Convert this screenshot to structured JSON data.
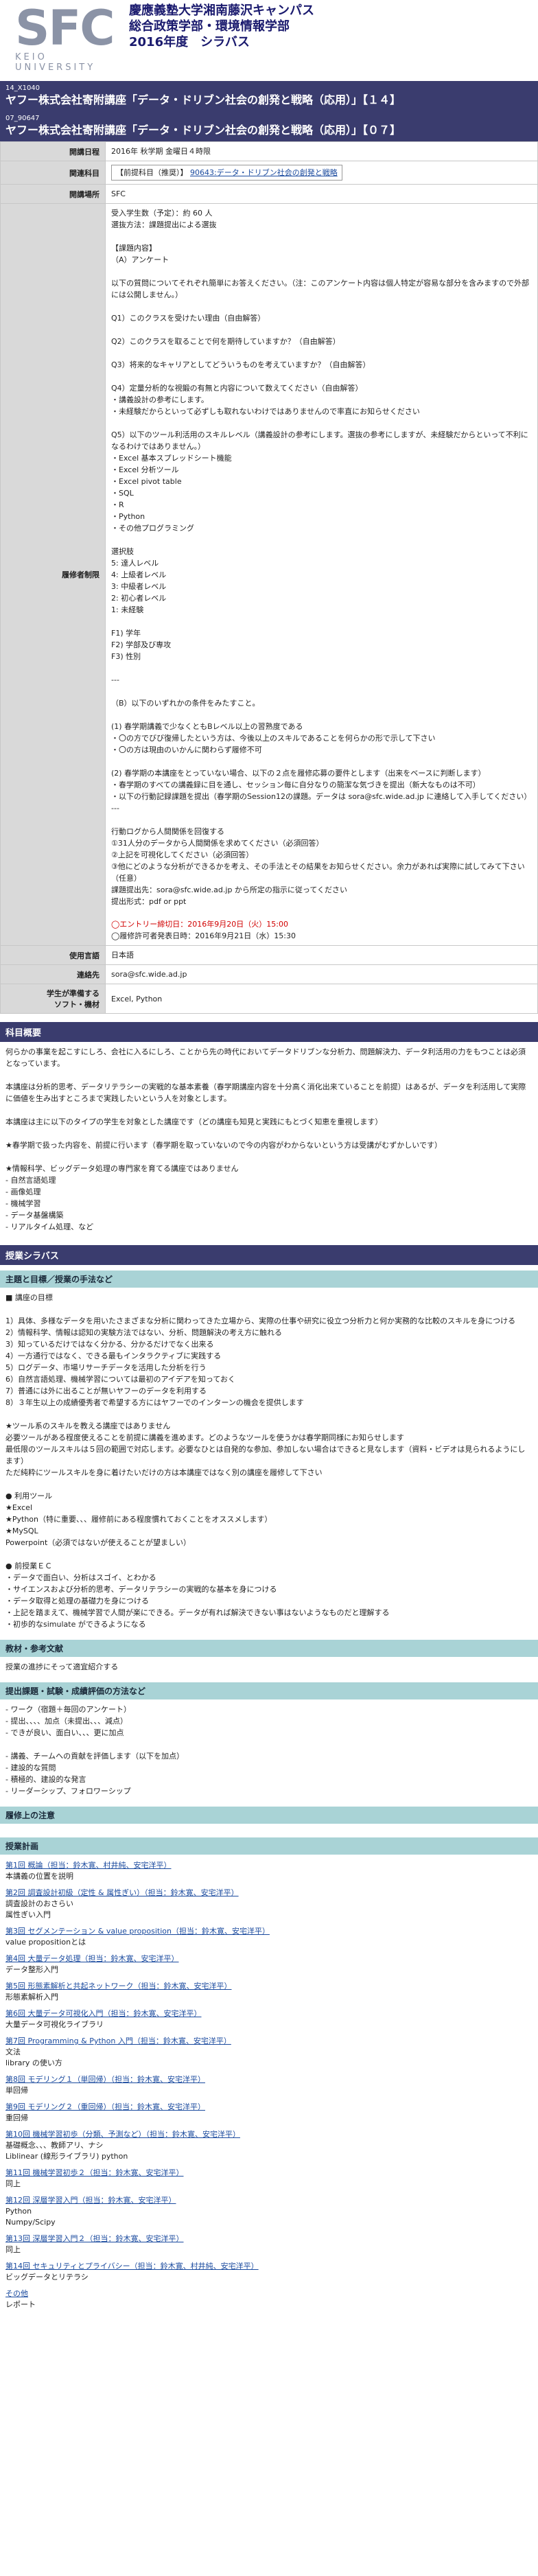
{
  "header": {
    "logo_text": "SFC",
    "logo_sub": "KEIO UNIVERSITY",
    "title_line1": "慶應義塾大学湘南藤沢キャンパス",
    "title_line2": "総合政策学部・環境情報学部",
    "title_line3": "2016年度　シラバス"
  },
  "courses": [
    {
      "code": "14_X1040",
      "title": "ヤフー株式会社寄附講座「データ・ドリブン社会の創発と戦略（応用）」【１４】"
    },
    {
      "code": "07_90647",
      "title": "ヤフー株式会社寄附講座「データ・ドリブン社会の創発と戦略（応用）」【０７】"
    }
  ],
  "info": {
    "period_label": "開講日程",
    "period_value": "2016年 秋学期 金曜日４時限",
    "related_label": "関連科目",
    "related_prefix": "【前提科目（推奨）】",
    "related_link": "90643:データ・ドリブン社会の創発と戦略",
    "place_label": "開講場所",
    "place_value": "SFC",
    "requirements_label": "履修者制限",
    "requirements_text": "受入学生数（予定）：約 60 人\n選抜方法：課題提出による選抜\n\n【課題内容】\n（A）アンケート\n\n以下の質問についてそれぞれ簡単にお答えください。（注：このアンケート内容は個人特定が容易な部分を含みますので外部には公開しません。）\n\nQ1）このクラスを受けたい理由（自由解答）\n\nQ2）このクラスを取ることで何を期待していますか？（自由解答）\n\nQ3）将来的なキャリアとしてどういうものを考えていますか？（自由解答）\n\nQ4）定量分析的な視鍛の有無と内容について数えてください（自由解答）\n・講義設計の参考にします。\n・未経験だからといって必ずしも取れないわけではありませんので率直にお知らせください\n\nQ5）以下のツール利活用のスキルレベル（講義設計の参考にします。選抜の参考にしますが、未経験だからといって不利になるわけではありません。）\n・Excel 基本スプレッドシート機能\n・Excel 分析ツール\n・Excel pivot table\n・SQL\n・R\n・Python\n・その他プログラミング\n\n選択肢\n5: 達人レベル\n4: 上級者レベル\n3: 中級者レベル\n2: 初心者レベル\n1: 未経験\n\nF1) 学年\nF2) 学部及び専攻\nF3) 性別\n\n---\n\n（B）以下のいずれかの条件をみたすこと。\n\n(1) 春学期講義で少なくともBレベル以上の習熟度である\n・〇の方でびび復帰したという方は、今後以上のスキルであることを何らかの形で示して下さい\n・〇の方は現由のいかんに関わらず履修不可\n\n(2) 春学期の本講座をとっていない場合、以下の２点を履修応募の要件とします（出来をベースに判断します）\n・春学期のすべての講義録に目を通し、セッション毎に自分なりの簡潔な気づきを提出（新大なものは不可）\n・以下の行動記録課題を提出（春学期のSession12の課題。データは sora@sfc.wide.ad.jp に連絡して入手してください）\n---\n\n行動ログから人間関係を回復する\n①31人分のデータから人間関係を求めてください（必須回答）\n②上記を可視化してください（必須回答）\n③他にどのような分析ができるかを考え、その手法とその結果をお知らせください。余力があれば実際に試してみて下さい（任意）\n課題提出先：sora@sfc.wide.ad.jp から所定の指示に従ってください\n提出形式：pdf or ppt",
    "entry_deadline": "◯エントリー締切日：2016年9月20日（火）15:00",
    "announce_date": "◯履修許可者発表日時：2016年9月21日（水）15:30",
    "language_label": "使用言語",
    "language_value": "日本語",
    "contact_label": "連絡先",
    "contact_value": "sora@sfc.wide.ad.jp",
    "software_label": "学生が準備する\nソフト・機材",
    "software_value": "Excel, Python"
  },
  "overview": {
    "heading": "科目概要",
    "text": "何らかの事業を起こすにしろ、会社に入るにしろ、ことから先の時代においてデータドリブンな分析力、問題解決力、データ利活用の力をもつことは必須となっています。\n\n本講座は分析的思考、データリテラシーの実戦的な基本素養（春学期講座内容を十分高く消化出来ていることを前提）はあるが、データを利活用して実際に価値を生み出すところまで実践したいという人を対象とします。\n\n本講座は主に以下のタイプの学生を対象とした講座です（どの講座も知見と実践にもとづく知恵を重視します）\n\n★春学期で扱った内容を、前提に行います（春学期を取っていないので今の内容がわからないという方は受講がむずかしいです）\n\n★情報科学、ビッグデータ処理の専門家を育てる講座ではありません\n- 自然言語処理\n- 画像処理\n- 機械学習\n- データ基盤構築\n- リアルタイム処理、など"
  },
  "syllabus": {
    "heading": "授業シラバス",
    "theme_heading": "主題と目標／授業の手法など",
    "theme_text": "■ 講座の目標\n\n1）具体、多様なデータを用いたさまざまな分析に関わってきた立場から、実際の仕事や研究に役立つ分析力と何か実務的な比較のスキルを身につける\n2）情報科学、情報は認知の実験方法ではない、分析、問題解決の考え方に触れる\n3）知っているだけではなく分かる、分かるだけでなく出来る\n4）一方通行ではなく、できる最もインタラクティブに実践する\n5）ログデータ、市場リサーチデータを活用した分析を行う\n6）自然言語処理、機械学習については最初のアイデアを知っておく\n7）普通には外に出ることが無いヤフーのデータを利用する\n8）３年生以上の成績優秀者で希望する方にはヤフーでのインターンの機会を提供します\n\n★ツール系のスキルを教える講座ではありません\n必要ツールがある程度使えることを前提に講義を進めます。どのようなツールを使うかは春学期同様にお知らせします\n最低限のツールスキルは５回の範囲で対応します。必要なひとは自発的な参加、参加しない場合はできると見なします（資料・ビデオは見られるようにします）\nただ純粋にツールスキルを身に着けたいだけの方は本講座ではなく別の講座を履修して下さい\n\n● 利用ツール\n★Excel\n★Python（特に重要、、、履修前にある程度慣れておくことをオススメします）\n★MySQL\nPowerpoint（必須ではないが使えることが望ましい）\n\n● 前授業ＥＣ\n・データで面白い、分析はスゴイ、とわかる\n・サイエンスおよび分析的思考、データリテラシーの実戦的な基本を身につける\n・データ取得と処理の基礎力を身につける\n・上記を踏まえて、機械学習で人間が楽にできる。データが有れば解決できない事はないようなものだと理解する\n・初歩的なsimulate ができるようになる",
    "materials_heading": "教材・参考文献",
    "materials_text": "授業の進捗にそって適宜紹介する",
    "grading_heading": "提出課題・試験・成績評価の方法など",
    "grading_text": "- ワーク（宿題＋毎回のアンケート）\n- 提出、、、、加点（未提出、、、減点）\n- できが良い、面白い、、、更に加点\n\n- 講義、チームへの貢献を評価します（以下を加点）\n- 建設的な質問\n- 積極的、建設的な発言\n- リーダーシップ、フォロワーシップ",
    "notes_heading": "履修上の注意",
    "notes_text": "",
    "plan_heading": "授業計画",
    "plan": [
      {
        "title": "第1回 概論（担当：鈴木寛、村井純、安宅洋平）",
        "desc": "本講義の位置を説明"
      },
      {
        "title": "第2回 調査設計初級（定性 & 属性ぎい）（担当：鈴木寛、安宅洋平）",
        "desc": "調査設計のおさらい\n属性ぎい入門"
      },
      {
        "title": "第3回 セグメンテーション & value proposition（担当：鈴木寛、安宅洋平）",
        "desc": "value propositionとは"
      },
      {
        "title": "第4回 大量データ処理（担当：鈴木寛、安宅洋平）",
        "desc": "データ整形入門"
      },
      {
        "title": "第5回 形態素解析と共起ネットワーク（担当：鈴木寛、安宅洋平）",
        "desc": "形態素解析入門"
      },
      {
        "title": "第6回 大量データ可視化入門（担当：鈴木寛、安宅洋平）",
        "desc": "大量データ可視化ライブラリ"
      },
      {
        "title": "第7回 Programming & Python 入門（担当：鈴木寛、安宅洋平）",
        "desc": "文法\nlibrary の使い方"
      },
      {
        "title": "第8回 モデリング１（単回帰）（担当：鈴木寛、安宅洋平）",
        "desc": "単回帰"
      },
      {
        "title": "第9回 モデリング２（重回帰）（担当：鈴木寛、安宅洋平）",
        "desc": "重回帰"
      },
      {
        "title": "第10回 機械学習初歩（分類、予測など）（担当：鈴木寛、安宅洋平）",
        "desc": "基礎概念、、、教師アリ、ナシ\nLiblinear (線形ライブラリ) python"
      },
      {
        "title": "第11回 機械学習初歩２（担当：鈴木寛、安宅洋平）",
        "desc": "同上"
      },
      {
        "title": "第12回 深層学習入門（担当：鈴木寛、安宅洋平）",
        "desc": "Python\nNumpy/Scipy"
      },
      {
        "title": "第13回 深層学習入門２（担当：鈴木寛、安宅洋平）",
        "desc": "同上"
      },
      {
        "title": "第14回 セキュリティとプライバシー（担当：鈴木寛、村井純、安宅洋平）",
        "desc": "ビッグデータとリテラシ"
      },
      {
        "title": "その他",
        "desc": "レポート"
      }
    ]
  }
}
